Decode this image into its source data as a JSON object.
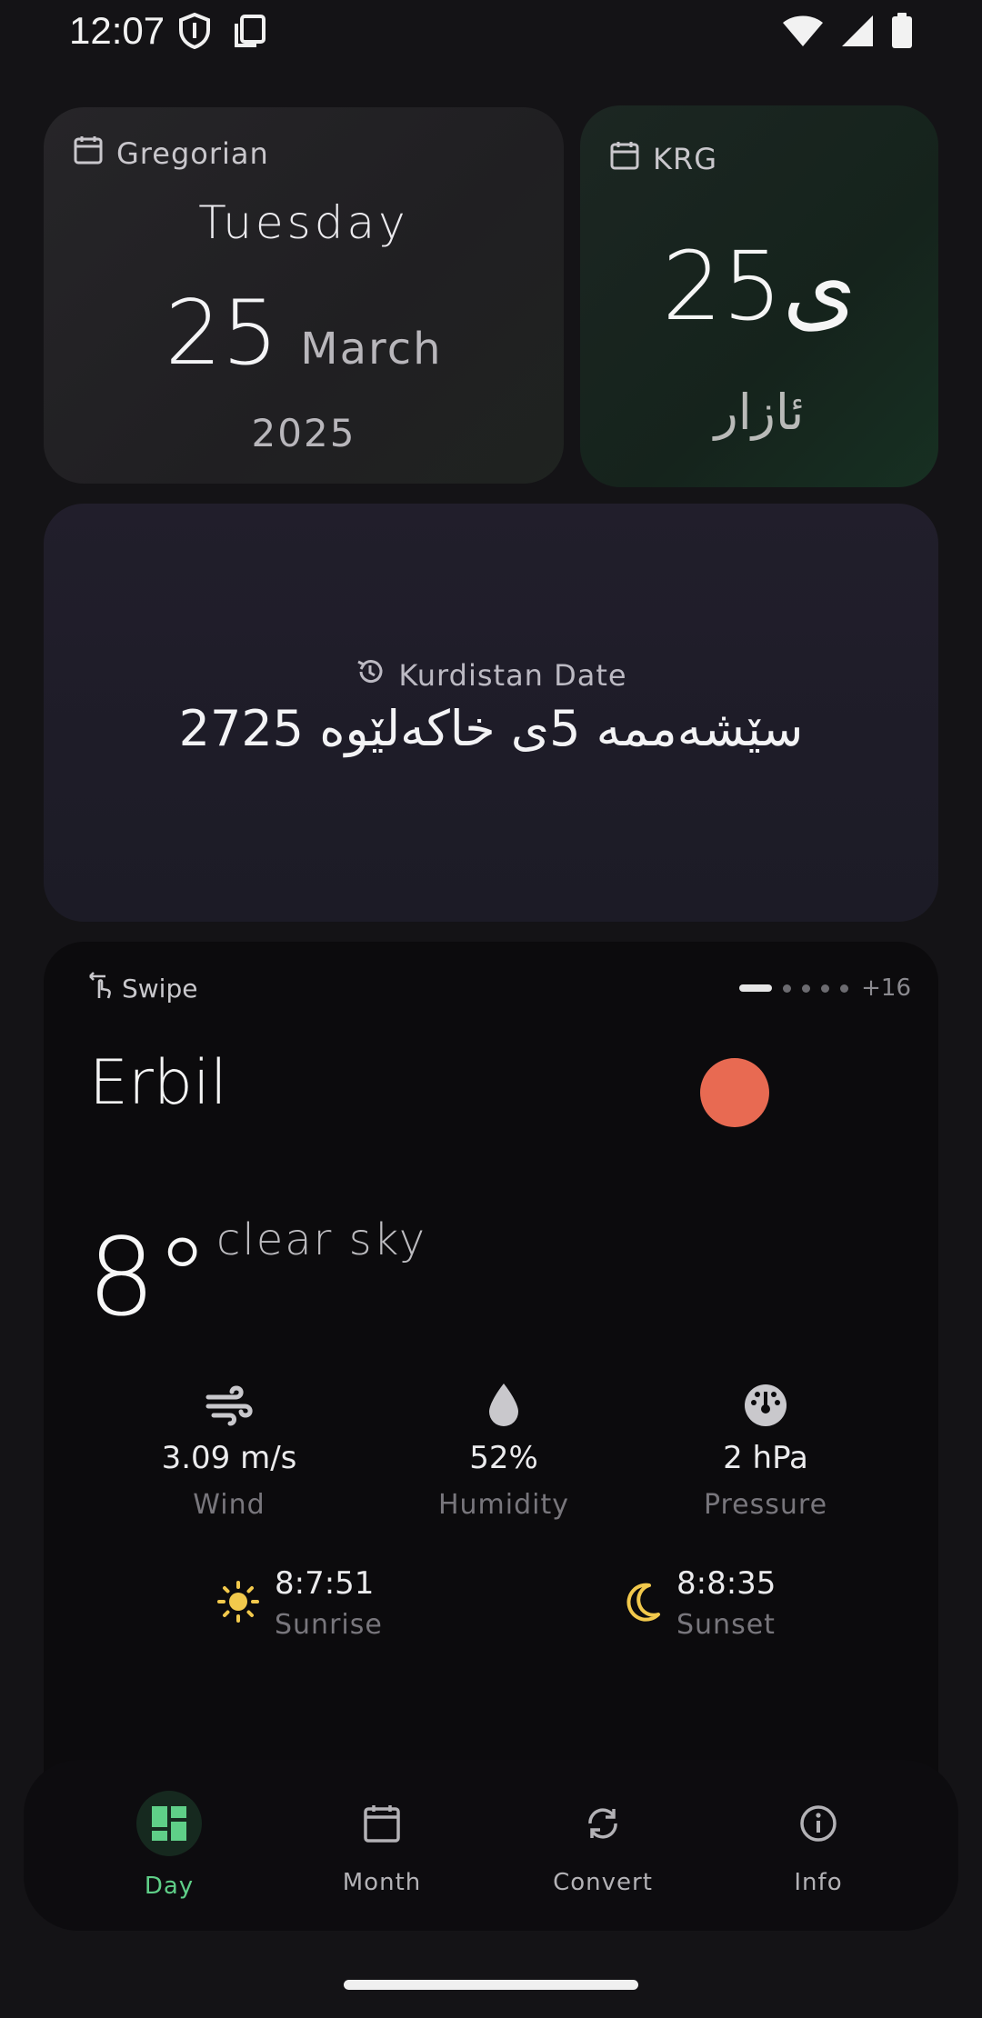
{
  "status_bar": {
    "time": "12:07",
    "icons": [
      "shield-icon",
      "screenshot-icon",
      "wifi-icon",
      "signal-icon",
      "battery-icon"
    ]
  },
  "gregorian": {
    "label": "Gregorian",
    "weekday": "Tuesday",
    "day": "25",
    "month": "March",
    "year": "2025"
  },
  "krg": {
    "label": "KRG",
    "day": "25ی",
    "month": "ئازار"
  },
  "kurdistan": {
    "label": "Kurdistan Date",
    "date": "سێشەممە 5ی خاکەلێوە 2725"
  },
  "weather": {
    "swipe_label": "Swipe",
    "pager_more": "+16",
    "city": "Erbil",
    "temperature": "8°",
    "condition": "clear sky",
    "wind": {
      "value": "3.09 m/s",
      "label": "Wind"
    },
    "humidity": {
      "value": "52%",
      "label": "Humidity"
    },
    "pressure": {
      "value": "2 hPa",
      "label": "Pressure"
    },
    "sunrise": {
      "time": "8:7:51",
      "label": "Sunrise"
    },
    "sunset": {
      "time": "8:8:35",
      "label": "Sunset"
    },
    "sun_color": "#e86a52"
  },
  "nav": {
    "items": [
      {
        "label": "Day",
        "icon": "dashboard-icon",
        "active": true
      },
      {
        "label": "Month",
        "icon": "calendar-icon",
        "active": false
      },
      {
        "label": "Convert",
        "icon": "sync-icon",
        "active": false
      },
      {
        "label": "Info",
        "icon": "info-icon",
        "active": false
      }
    ],
    "accent": "#5fcf88"
  }
}
